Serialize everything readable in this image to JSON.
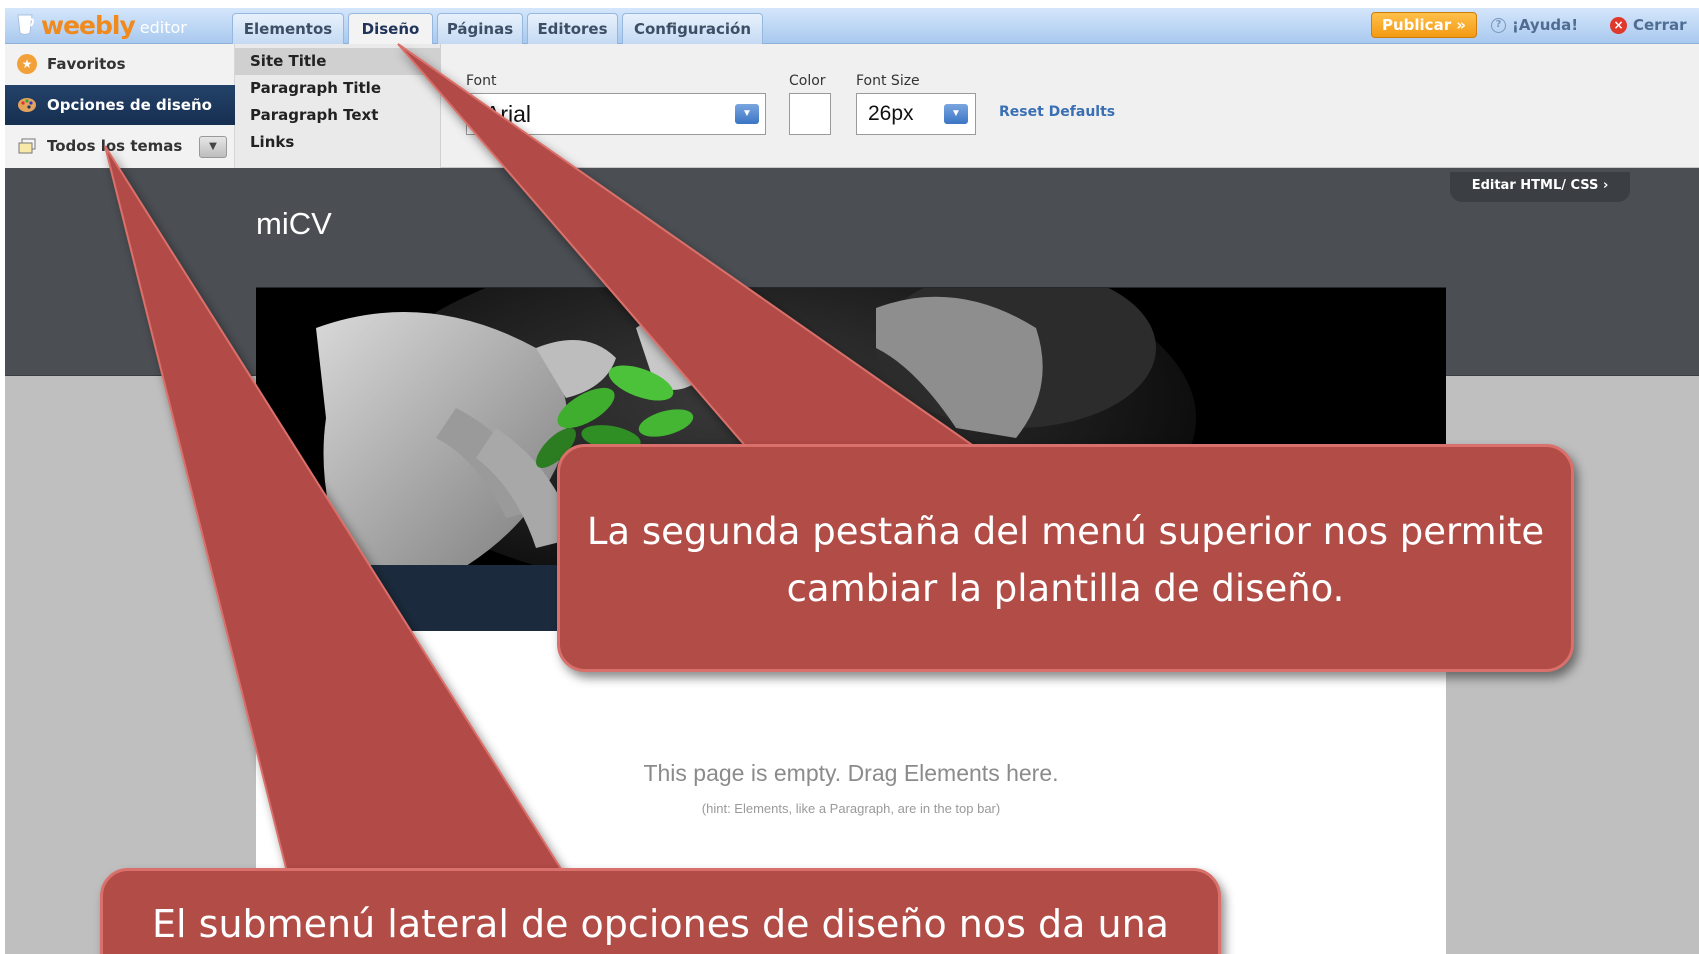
{
  "topbar": {
    "logo_text": "weebly",
    "logo_suffix": "editor",
    "tabs": [
      {
        "label": "Elementos"
      },
      {
        "label": "Diseño"
      },
      {
        "label": "Páginas"
      },
      {
        "label": "Editores"
      },
      {
        "label": "Configuración"
      }
    ],
    "publish_label": "Publicar »",
    "help_label": "¡Ayuda!",
    "close_label": "Cerrar"
  },
  "sidebar": {
    "items": [
      {
        "label": "Favoritos",
        "icon": "star-icon"
      },
      {
        "label": "Opciones de diseño",
        "icon": "palette-icon"
      },
      {
        "label": "Todos los temas",
        "icon": "themes-icon"
      }
    ]
  },
  "submenu": {
    "items": [
      {
        "label": "Site Title"
      },
      {
        "label": "Paragraph Title"
      },
      {
        "label": "Paragraph Text"
      },
      {
        "label": "Links"
      }
    ]
  },
  "font_options": {
    "font_label": "Font",
    "font_value": "Arial",
    "color_label": "Color",
    "color_value": "#ffffff",
    "size_label": "Font Size",
    "size_value": "26px",
    "reset_label": "Reset Defaults"
  },
  "site": {
    "edit_html_label": "Editar HTML/ CSS ›",
    "title": "miCV",
    "empty_message": "This page is empty. Drag Elements here.",
    "empty_hint": "(hint: Elements, like a Paragraph, are in the top bar)"
  },
  "callouts": {
    "top": "La segunda pestaña del menú superior nos permite cambiar la plantilla de diseño.",
    "bottom": "El submenú lateral de opciones de diseño nos da una"
  },
  "colors": {
    "accent": "#f08a1c",
    "callout": "#b24c46",
    "nav_active": "#1c3a61"
  }
}
